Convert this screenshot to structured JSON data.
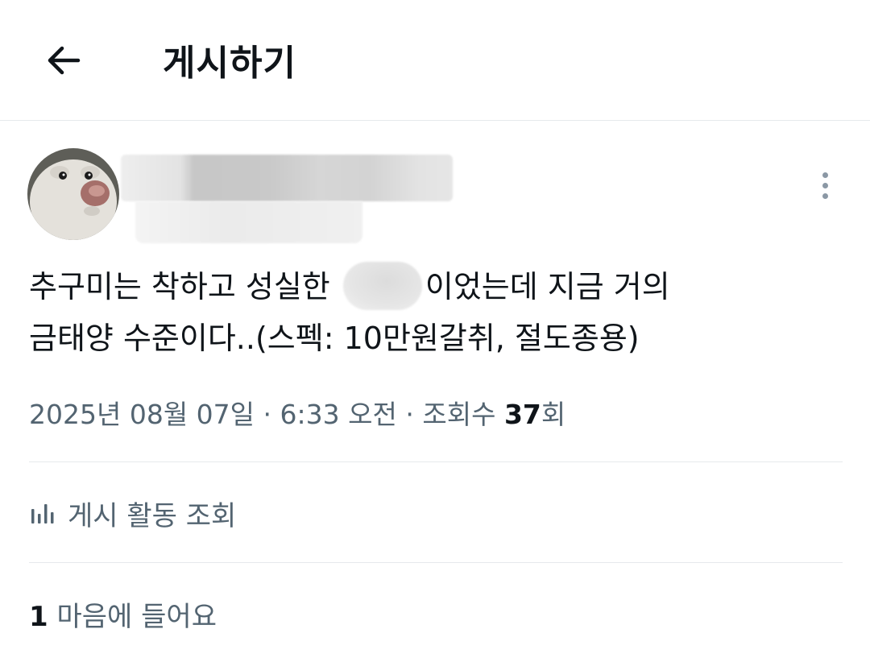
{
  "header": {
    "back_icon": "arrow-left-icon",
    "title": "게시하기"
  },
  "post": {
    "avatar": "hamster-avatar",
    "more_icon": "more-vertical-icon",
    "text_line1_a": "추구미는 착하고 성실한",
    "text_line1_b": "이었는데 지금 거의",
    "text_line2": "금태양 수준이다..(스펙: 10만원갈취, 절도종용)",
    "date": "2025년 08월 07일",
    "sep1": "·",
    "time": "6:33 오전",
    "sep2": "·",
    "views_label": "조회수",
    "views_count": "37",
    "views_suffix": "회"
  },
  "activity": {
    "icon": "bar-chart-icon",
    "label": "게시 활동 조회"
  },
  "likes": {
    "count": "1",
    "label": "마음에 들어요"
  },
  "colors": {
    "text_primary": "#0f1419",
    "text_secondary": "#536471",
    "divider": "#e6e9ec"
  }
}
